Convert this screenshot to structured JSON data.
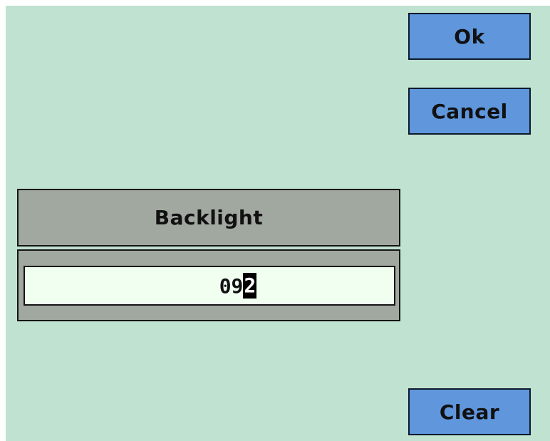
{
  "buttons": {
    "ok_label": "Ok",
    "cancel_label": "Cancel",
    "clear_label": "Clear"
  },
  "dialog": {
    "title": "Backlight",
    "value_prefix": "09",
    "value_cursor_char": "2"
  },
  "colors": {
    "screen_background": "#c0e2d0",
    "button_fill": "#5f96dc",
    "panel_fill": "#a1a8a0",
    "field_fill": "#f1fff1"
  }
}
